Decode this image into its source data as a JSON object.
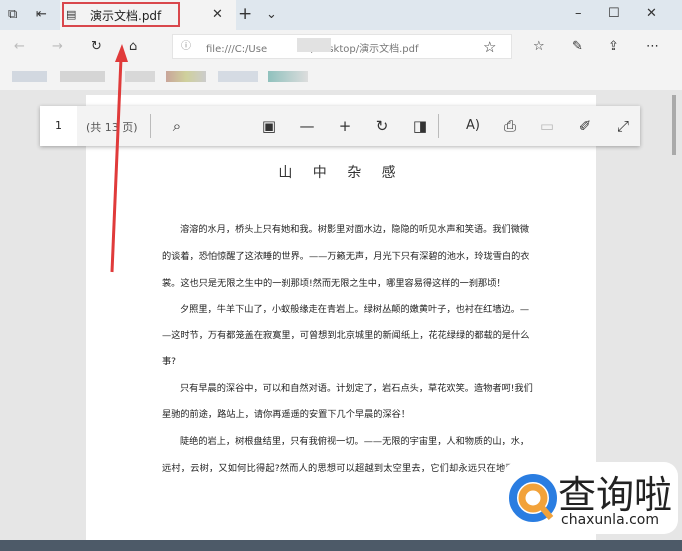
{
  "browser": {
    "tab_title": "演示文档.pdf",
    "url_prefix": "file:///C:/Use",
    "url_suffix": "/Desktop/演示文档.pdf",
    "icons": [
      "tab-set-aside-icon",
      "tabs-icon",
      "pdf-file-icon",
      "close-icon",
      "new-tab-icon",
      "chevron-down-icon",
      "minimize-icon",
      "maximize-icon",
      "window-close-icon",
      "back-icon",
      "forward-icon",
      "refresh-icon",
      "home-icon",
      "info-icon",
      "favorite-star-icon",
      "favorites-list-icon",
      "pen-icon",
      "share-icon",
      "more-icon"
    ]
  },
  "pdf_toolbar": {
    "page_number": "1",
    "page_total": "(共 13 页)"
  },
  "document": {
    "title": "山 中 杂 感",
    "lines": [
      "溶溶的水月，桥头上只有她和我。树影里对面水边，隐隐的听见水声和笑语。我们微微",
      "的谈着，恐怕惊醒了这浓睡的世界。——万籁无声，月光下只有深碧的池水，玲珑雪白的衣",
      "裳。这也只是无限之生中的一刹那顷!然而无限之生中，哪里容易得这样的一刹那顷！",
      "夕照里，牛羊下山了，小蚁般缘走在青岩上。绿树丛颠的嫩黄叶子，也衬在红墙边。—",
      "—这时节，万有都笼盖在寂寞里，可曾想到北京城里的新闻纸上，花花绿绿的都载的是什么",
      "事?",
      "只有早晨的深谷中，可以和自然对语。计划定了，岩石点头，草花欢笑。造物者呵!我们",
      "星驰的前途，路站上，请你再遥遥的安置下几个早晨的深谷！",
      "陡绝的岩上，树根盘结里，只有我俯视一切。——无限的宇宙里，人和物质的山，水，",
      "远村，云树，又如何比得起?然而人的思想可以超越到太空里去，它们却永远只在地面上"
    ]
  },
  "watermark": {
    "cn": "查询啦",
    "en": "chaxunla.com"
  }
}
